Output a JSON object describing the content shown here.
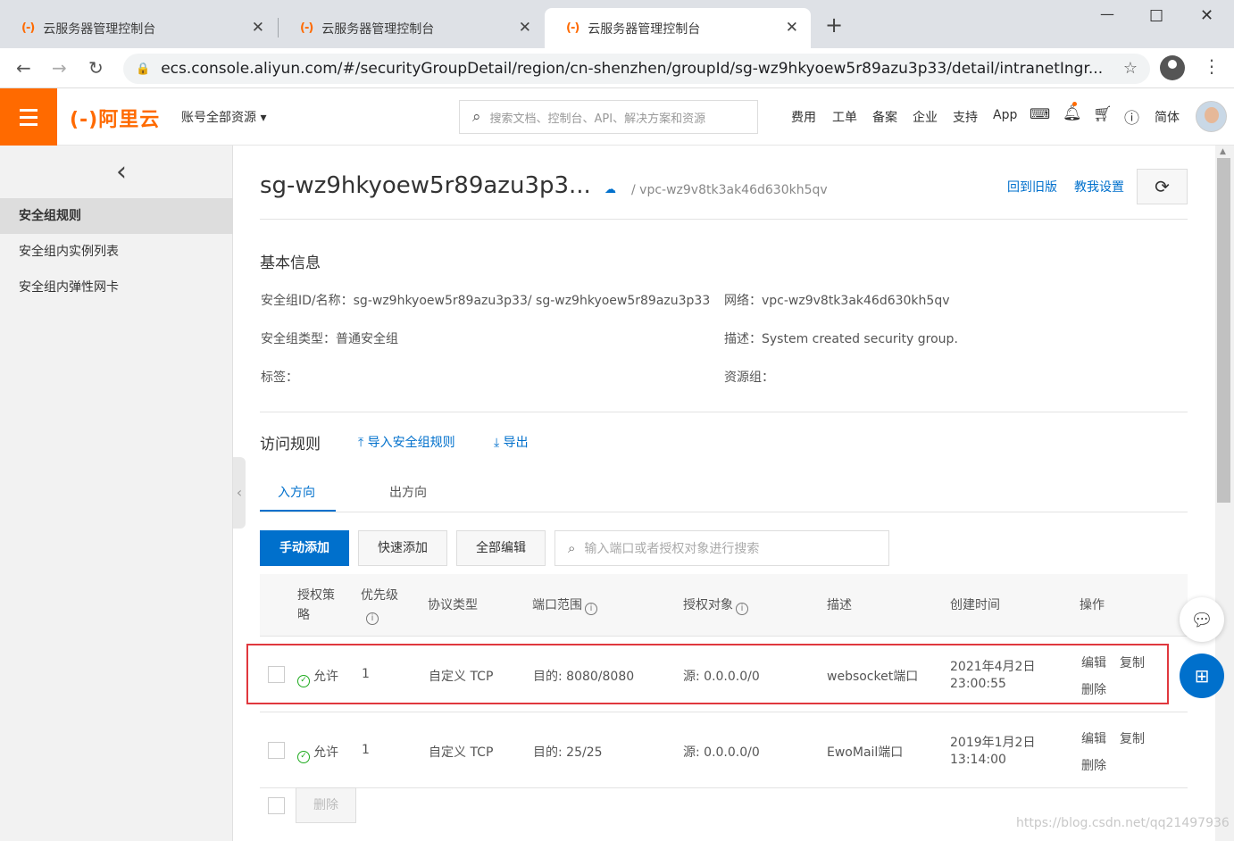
{
  "browser": {
    "tabs": [
      {
        "logo": "(-)",
        "title": "云服务器管理控制台"
      },
      {
        "logo": "(-)",
        "title": "云服务器管理控制台"
      },
      {
        "logo": "(-)",
        "title": "云服务器管理控制台"
      }
    ],
    "url": "ecs.console.aliyun.com/#/securityGroupDetail/region/cn-shenzhen/groupId/sg-wz9hkyoew5r89azu3p33/detail/intranetIngr..."
  },
  "topnav": {
    "brand": "(-)阿里云",
    "account": "账号全部资源 ▾",
    "search_placeholder": "搜索文档、控制台、API、解决方案和资源",
    "items": [
      "费用",
      "工单",
      "备案",
      "企业",
      "支持",
      "App",
      "简体"
    ]
  },
  "sidebar": {
    "items": [
      "安全组规则",
      "安全组内实例列表",
      "安全组内弹性网卡"
    ]
  },
  "header": {
    "title": "sg-wz9hkyoew5r89azu3p3...",
    "vpc": "/  vpc-wz9v8tk3ak46d630kh5qv",
    "link_old": "回到旧版",
    "link_help": "教我设置"
  },
  "basic": {
    "heading": "基本信息",
    "sg_label": "安全组ID/名称：",
    "sg_value": "sg-wz9hkyoew5r89azu3p33/ sg-wz9hkyoew5r89azu3p33",
    "net_label": "网络：",
    "net_value": "vpc-wz9v8tk3ak46d630kh5qv",
    "type_label": "安全组类型：",
    "type_value": "普通安全组",
    "desc_label": "描述：",
    "desc_value": "System created security group.",
    "tag_label": "标签：",
    "rg_label": "资源组："
  },
  "rules": {
    "heading": "访问规则",
    "import": "导入安全组规则",
    "export": "导出",
    "tab_in": "入方向",
    "tab_out": "出方向",
    "btn_manual": "手动添加",
    "btn_quick": "快速添加",
    "btn_edit_all": "全部编辑",
    "search_placeholder": "输入端口或者授权对象进行搜索",
    "columns": {
      "policy": "授权策略",
      "priority": "优先级",
      "protocol": "协议类型",
      "port": "端口范围",
      "target": "授权对象",
      "desc": "描述",
      "created": "创建时间",
      "ops": "操作"
    },
    "rows": [
      {
        "policy": "允许",
        "priority": "1",
        "protocol": "自定义 TCP",
        "port": "目的: 8080/8080",
        "target": "源: 0.0.0.0/0",
        "desc": "websocket端口",
        "date": "2021年4月2日",
        "time": "23:00:55",
        "edit": "编辑",
        "copy": "复制",
        "del": "删除"
      },
      {
        "policy": "允许",
        "priority": "1",
        "protocol": "自定义 TCP",
        "port": "目的: 25/25",
        "target": "源: 0.0.0.0/0",
        "desc": "EwoMail端口",
        "date": "2019年1月2日",
        "time": "13:14:00",
        "edit": "编辑",
        "copy": "复制",
        "del": "删除"
      }
    ],
    "btn_delete": "删除"
  },
  "watermark": "https://blog.csdn.net/qq21497936",
  "colors": {
    "brand": "#ff6a00",
    "link": "#0070cc",
    "highlight": "#e0383e"
  }
}
